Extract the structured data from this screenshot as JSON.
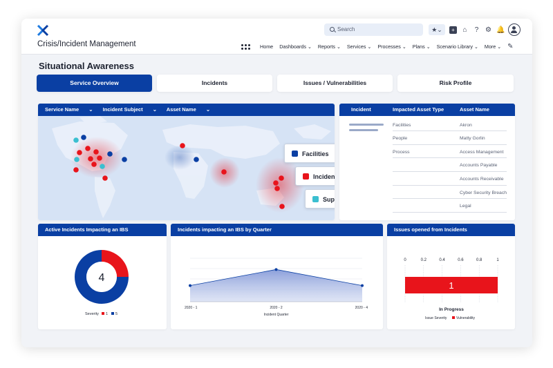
{
  "app": {
    "title": "Crisis/Incident Management"
  },
  "search": {
    "placeholder": "Search"
  },
  "nav": {
    "items": [
      {
        "label": "Home",
        "chevron": false
      },
      {
        "label": "Dashboards",
        "chevron": true
      },
      {
        "label": "Reports",
        "chevron": true
      },
      {
        "label": "Services",
        "chevron": true
      },
      {
        "label": "Processes",
        "chevron": true
      },
      {
        "label": "Plans",
        "chevron": true
      },
      {
        "label": "Scenario Library",
        "chevron": true
      },
      {
        "label": "More",
        "chevron": true
      }
    ]
  },
  "page": {
    "title": "Situational Awareness"
  },
  "tabs": [
    {
      "label": "Service Overview",
      "active": true
    },
    {
      "label": "Incidents",
      "active": false
    },
    {
      "label": "Issues / Vulnerabilities",
      "active": false
    },
    {
      "label": "Risk Profile",
      "active": false
    }
  ],
  "map": {
    "filters": [
      "Service Name",
      "Incident Subject",
      "Asset Name"
    ],
    "legend": [
      {
        "label": "Facilities",
        "color": "#0a3fa3"
      },
      {
        "label": "Incident",
        "color": "#e8141b"
      },
      {
        "label": "Supplier",
        "color": "#3bbfd0"
      }
    ]
  },
  "asset_table": {
    "columns": [
      "Incident",
      "Impacted Asset Type",
      "Asset Name"
    ],
    "types": [
      "Facilities",
      "People",
      "Process"
    ],
    "names": [
      "Akron",
      "Matty Gorlin",
      "Access Management",
      "Accounts Payable",
      "Accounts Receivable",
      "Cyber Security Breach",
      "Legal"
    ]
  },
  "donut": {
    "title": "Active Incidents Impacting an IBS",
    "center_value": "4",
    "legend_title": "Severity",
    "legend": [
      {
        "label": "1",
        "color": "#e8141b"
      },
      {
        "label": "5",
        "color": "#0a3fa3"
      }
    ],
    "fraction_red": 0.25
  },
  "area_chart": {
    "title": "Incidents impacting an IBS by Quarter",
    "xlabel": "Incident Quarter",
    "categories": [
      "2020 - 1",
      "2020 - 2",
      "2020 - 4"
    ]
  },
  "bar_chart": {
    "title": "Issues opened from Incidents",
    "ticks": [
      "0",
      "0.2",
      "0.4",
      "0.6",
      "0.8",
      "1"
    ],
    "bar_value_label": "1",
    "category": "In Progress",
    "legend_title": "Issue Severity",
    "legend_label": "Vulnerability",
    "color": "#e8141b"
  },
  "chart_data": [
    {
      "type": "pie",
      "title": "Active Incidents Impacting an IBS",
      "categories": [
        "1",
        "5"
      ],
      "values": [
        1,
        3
      ]
    },
    {
      "type": "area",
      "title": "Incidents impacting an IBS by Quarter",
      "xlabel": "Incident Quarter",
      "categories": [
        "2020 - 1",
        "2020 - 2",
        "2020 - 4"
      ],
      "values": [
        1,
        2,
        1
      ],
      "ylim": [
        0,
        3
      ]
    },
    {
      "type": "bar",
      "title": "Issues opened from Incidents",
      "categories": [
        "In Progress"
      ],
      "values": [
        1
      ],
      "xlim": [
        0,
        1
      ]
    }
  ]
}
